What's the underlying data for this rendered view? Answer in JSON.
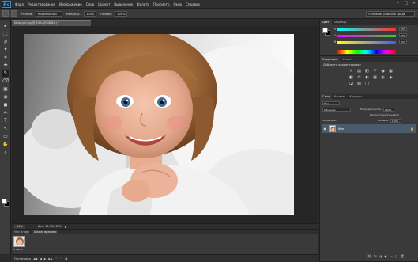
{
  "app": {
    "logo": "Ps",
    "menu": [
      "Файл",
      "Редактирование",
      "Изображение",
      "Слои",
      "Шрифт",
      "Выделение",
      "Фильтр",
      "Просмотр",
      "Окно",
      "Справка"
    ],
    "window_controls": [
      "–",
      "□",
      "✕"
    ]
  },
  "options": {
    "mode_label": "Режим:",
    "mode_value": "Нормальный",
    "opacity_label": "Непрозр.:",
    "opacity_value": "100%",
    "flow_label": "Нажим:",
    "flow_value": "100%",
    "workspace": "Основная рабочая среда"
  },
  "document": {
    "tab_title": "little-girl.jpg @ 25% (RGB/8#) *",
    "zoom": "25%",
    "doc_info": "Док: 18,7M/18,7M",
    "status_arrow": "▸"
  },
  "bottom_panel": {
    "tabs": [
      "Mini Bridge",
      "Шкала времени"
    ],
    "thumb_label": "0 сек. ▾"
  },
  "bottom_bar": {
    "items": [
      "Постановка",
      "◀◀",
      "◀",
      "▶",
      "▶▶",
      "⬚",
      "⬚",
      "▣"
    ]
  },
  "color_panel": {
    "tabs": [
      "Цвет",
      "Образцы"
    ],
    "rows": [
      {
        "letter": "R",
        "value": "255",
        "color": "#ff2d2d"
      },
      {
        "letter": "G",
        "value": "255",
        "color": "#30d030"
      },
      {
        "letter": "B",
        "value": "255",
        "color": "#3a5bff"
      }
    ]
  },
  "adjustments_panel": {
    "tabs": [
      "Коррекция",
      "Стили"
    ],
    "title": "Добавить корректировку",
    "icons": [
      "☼",
      "▤",
      "◩",
      "▽",
      "◑",
      "▦",
      "◧",
      "⚖",
      "◐",
      "▣",
      "◍",
      "◈",
      "◪",
      "▧",
      "◫"
    ]
  },
  "layers_panel": {
    "tabs": [
      "Слои",
      "Каналы",
      "Контуры"
    ],
    "kind_label": "Вид",
    "blend_mode": "Обычные",
    "opacity_label": "Непрозрачность:",
    "opacity_value": "100%",
    "lock_label": "Закрепить:",
    "fill_label": "Заливка:",
    "fill_value": "100%",
    "layer_name": "Фон",
    "unify_label": "Распространить кадр 1",
    "bottom_icons": [
      "⛓",
      "fx",
      "◑",
      "◐",
      "▭",
      "▢",
      "🗑"
    ]
  },
  "tools": [
    "▸",
    "⬚",
    "ρ",
    "✦",
    "⌗",
    "✚",
    "✎",
    "⌫",
    "▣",
    "◉",
    "◼",
    "✍",
    "T",
    "↖",
    "▭",
    "✋",
    "⌕"
  ],
  "colors": {
    "fg_swatch": "#ffffff",
    "bg_swatch": "#000000"
  }
}
